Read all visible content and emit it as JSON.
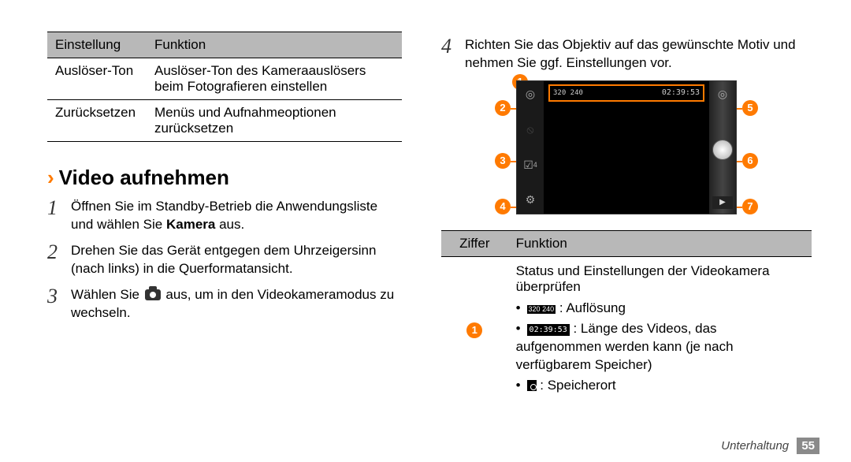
{
  "settings_table": {
    "headers": [
      "Einstellung",
      "Funktion"
    ],
    "rows": [
      {
        "setting": "Auslöser-Ton",
        "func": "Auslöser-Ton des Kameraauslösers beim Fotografieren einstellen"
      },
      {
        "setting": "Zurücksetzen",
        "func": "Menüs und Aufnahmeoptionen zurücksetzen"
      }
    ]
  },
  "section_title": "Video aufnehmen",
  "steps": {
    "s1a": "Öffnen Sie im Standby-Betrieb die Anwendungsliste und wählen Sie ",
    "s1b": "Kamera",
    "s1c": " aus.",
    "s2": "Drehen Sie das Gerät entgegen dem Uhrzeigersinn (nach links) in die Querformatansicht.",
    "s3a": "Wählen Sie ",
    "s3b": " aus, um in den Videokameramodus zu wechseln.",
    "s4": "Richten Sie das Objektiv auf das gewünschte Motiv und nehmen Sie ggf. Einstellungen vor."
  },
  "cam_status": {
    "resolution": "320\n240",
    "time": "02:39:53",
    "ev": "4"
  },
  "callout_numbers": {
    "n1": "1",
    "n2": "2",
    "n3": "3",
    "n4": "4",
    "n5": "5",
    "n6": "6",
    "n7": "7"
  },
  "ziffer_table": {
    "headers": [
      "Ziffer",
      "Funktion"
    ],
    "row1": {
      "badge": "1",
      "desc": "Status und Einstellungen der Videokamera überprüfen",
      "bullet_res_label": " : Auflösung",
      "bullet_time_label": " : Länge des Videos, das aufgenommen werden kann (je nach verfügbarem Speicher)",
      "bullet_storage_label": " : Speicherort",
      "res_icon_text": "320\n240",
      "time_icon_text": "02:39:53"
    }
  },
  "footer": {
    "section": "Unterhaltung",
    "page": "55"
  }
}
